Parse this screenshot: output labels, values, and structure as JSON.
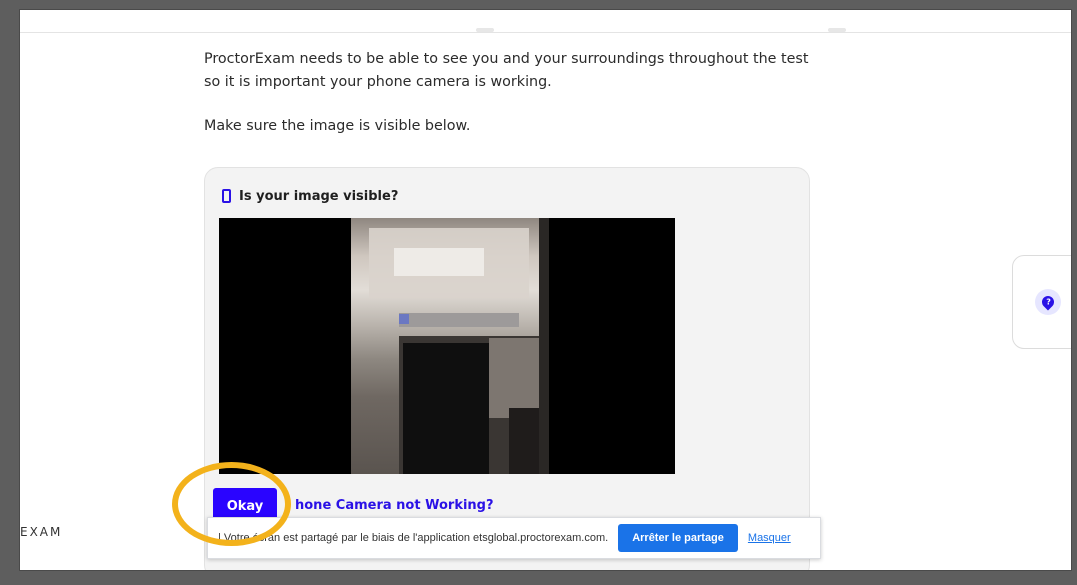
{
  "intro": {
    "line1": "ProctorExam needs to be able to see you and your surroundings throughout the test",
    "line2": "so it is important your phone camera is working.",
    "line3": "Make sure the image is visible below."
  },
  "card": {
    "title": "Is your image visible?",
    "okay_label": "Okay",
    "camera_link": "hone Camera not Working?"
  },
  "brand": {
    "partial": "EXAM"
  },
  "sharebar": {
    "text": "| Votre écran est partagé par le biais de l'application etsglobal.proctorexam.com.",
    "stop_label": "Arrêter le partage",
    "hide_label": "Masquer"
  },
  "help": {
    "icon": "help-question-icon"
  },
  "colors": {
    "accent": "#2a04ff",
    "highlight_ring": "#f3b21b",
    "chrome_button": "#1a73e8"
  }
}
